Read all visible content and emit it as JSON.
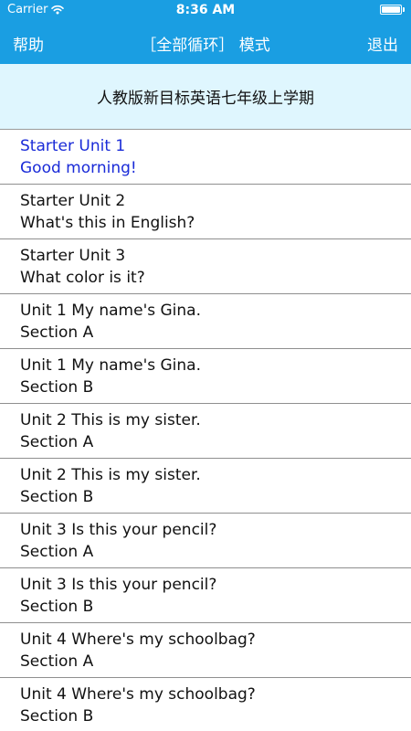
{
  "status_bar": {
    "carrier": "Carrier",
    "time": "8:36 AM",
    "wifi_icon": "wifi-icon",
    "battery_icon": "battery-icon",
    "battery_level": 1.0
  },
  "navbar": {
    "left": "帮助",
    "title": "［全部循环］ 模式",
    "right": "退出",
    "background_color": "#1a9ee2"
  },
  "book_title": "人教版新目标英语七年级上学期",
  "selected_color": "#1a2bd8",
  "lessons": [
    {
      "line1": "Starter Unit 1",
      "line2": "Good morning!",
      "selected": true
    },
    {
      "line1": "Starter Unit 2",
      "line2": "What's this in English?",
      "selected": false
    },
    {
      "line1": "Starter Unit 3",
      "line2": "What color is it?",
      "selected": false
    },
    {
      "line1": "Unit 1 My name's Gina.",
      "line2": "Section A",
      "selected": false
    },
    {
      "line1": "Unit 1 My name's Gina.",
      "line2": "Section B",
      "selected": false
    },
    {
      "line1": "Unit 2 This is my sister.",
      "line2": "Section A",
      "selected": false
    },
    {
      "line1": "Unit 2 This is my sister.",
      "line2": "Section B",
      "selected": false
    },
    {
      "line1": "Unit 3 Is this your pencil?",
      "line2": "Section A",
      "selected": false
    },
    {
      "line1": "Unit 3 Is this your pencil?",
      "line2": "Section B",
      "selected": false
    },
    {
      "line1": "Unit 4 Where's my schoolbag?",
      "line2": "Section A",
      "selected": false
    },
    {
      "line1": "Unit 4 Where's my schoolbag?",
      "line2": "Section B",
      "selected": false
    }
  ]
}
